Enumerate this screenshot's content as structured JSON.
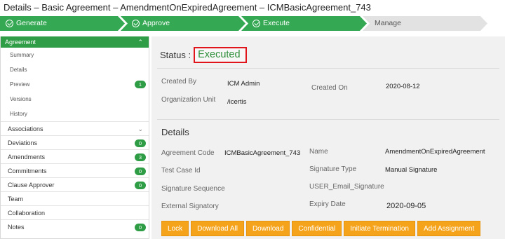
{
  "page_title": "Details – Basic Agreement – AmendmentOnExpiredAgreement – ICMBasicAgreement_743",
  "workflow": {
    "steps": [
      {
        "label": "Generate",
        "state": "done"
      },
      {
        "label": "Approve",
        "state": "done"
      },
      {
        "label": "Execute",
        "state": "done"
      },
      {
        "label": "Manage",
        "state": "pending"
      }
    ],
    "done_color": "#34a853",
    "pending_color": "#e2e2e2"
  },
  "sidebar": {
    "header": "Agreement",
    "sub_items": [
      {
        "label": "Summary"
      },
      {
        "label": "Details"
      },
      {
        "label": "Preview",
        "badge": "1"
      },
      {
        "label": "Versions"
      },
      {
        "label": "History"
      }
    ],
    "sections": [
      {
        "label": "Associations",
        "chevron": true
      },
      {
        "label": "Deviations",
        "badge": "0"
      },
      {
        "label": "Amendments",
        "badge": "3"
      },
      {
        "label": "Commitments",
        "badge": "0"
      },
      {
        "label": "Clause Approver",
        "badge": "0"
      },
      {
        "label": "Team"
      },
      {
        "label": "Collaboration"
      },
      {
        "label": "Notes",
        "badge": "0"
      }
    ]
  },
  "status": {
    "label": "Status :",
    "value": "Executed",
    "value_color": "#2e8f3a",
    "highlight_color": "#e0141b"
  },
  "summary": {
    "created_by_label": "Created By",
    "created_by_value": "ICM Admin",
    "created_on_label": "Created On",
    "created_on_value": "2020-08-12",
    "org_unit_label": "Organization Unit",
    "org_unit_value": "/icertis"
  },
  "details": {
    "title": "Details",
    "agreement_code_label": "Agreement Code",
    "agreement_code_value": "ICMBasicAgreement_743",
    "name_label": "Name",
    "name_value": "AmendmentOnExpiredAgreement",
    "test_case_label": "Test Case Id",
    "signature_type_label": "Signature Type",
    "signature_type_value": "Manual Signature",
    "signature_sequence_label": "Signature Sequence",
    "user_email_signature_label": "USER_Email_Signature",
    "external_signatory_label": "External Signatory",
    "expiry_date_label": "Expiry Date",
    "expiry_date_value": "2020-09-05"
  },
  "actions": [
    "Lock",
    "Download All",
    "Download",
    "Confidential",
    "Initiate Termination",
    "Add Assignment"
  ],
  "accent_color": "#f5a31a"
}
